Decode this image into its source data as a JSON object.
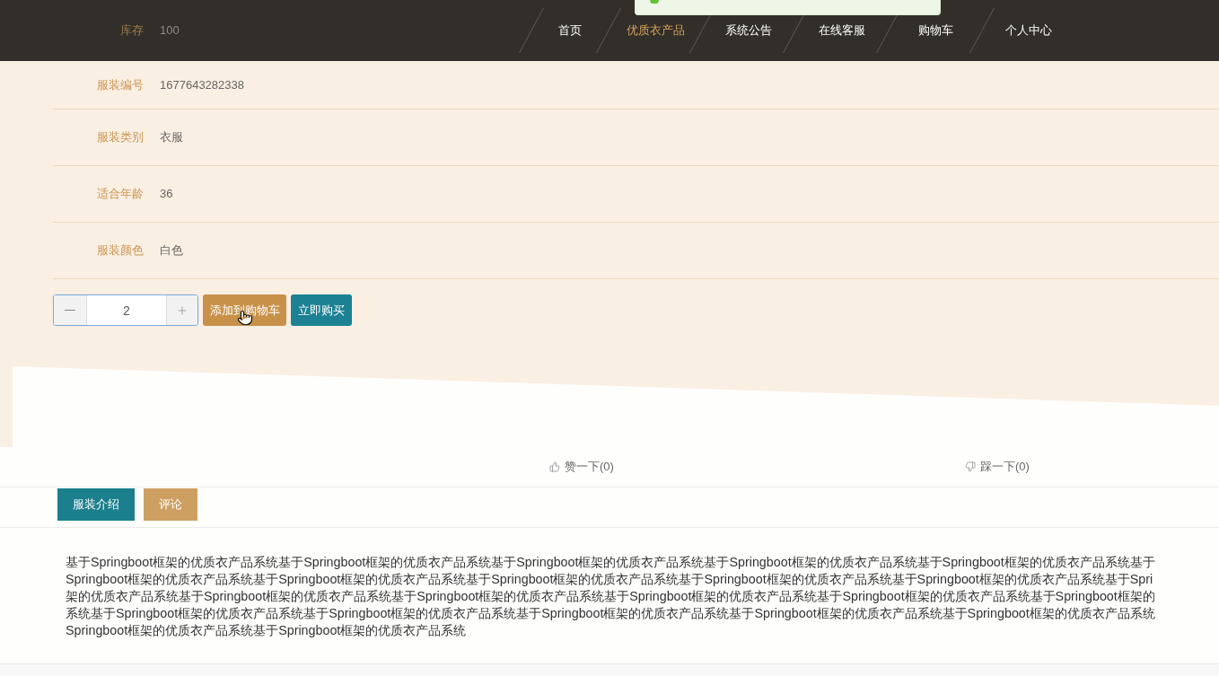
{
  "toast": {
    "kind": "success"
  },
  "nav": [
    {
      "label": "首页",
      "selected": false
    },
    {
      "label": "优质衣产品",
      "selected": true
    },
    {
      "label": "系统公告",
      "selected": false
    },
    {
      "label": "在线客服",
      "selected": false
    },
    {
      "label": "购物车",
      "selected": false
    },
    {
      "label": "个人中心",
      "selected": false
    }
  ],
  "details": [
    {
      "label": "库存",
      "value": "100"
    },
    {
      "label": "服装编号",
      "value": "1677643282338"
    },
    {
      "label": "服装类别",
      "value": "衣服"
    },
    {
      "label": "适合年龄",
      "value": "36"
    },
    {
      "label": "服装颜色",
      "value": "白色"
    }
  ],
  "quantity": {
    "value": "2"
  },
  "buttons": [
    {
      "kind": "add_to_cart",
      "label": "添加到购物车"
    },
    {
      "kind": "buy_now",
      "label": "立即购买"
    }
  ],
  "cursor": {
    "kind": "hand"
  },
  "votes": [
    {
      "kind": "like",
      "label": "赞一下(0)"
    },
    {
      "kind": "dislike",
      "label": "踩一下(0)"
    }
  ],
  "tabs": [
    {
      "label": "服装介绍",
      "selected": true
    },
    {
      "label": "评论",
      "selected": false
    }
  ],
  "description": {
    "lines": [
      "基于Springboot框架的优质衣产品系统基于Springboot框架的优质衣产品系统基于Springboot框架的优质衣产品系统基于Springboot框架的优质衣产品系统基于Springboot框架的优质衣产品系统基于",
      "Springboot框架的优质衣产品系统基于Springboot框架的优质衣产品系统基于Springboot框架的优质衣产品系统基于Springboot框架的优质衣产品系统基于Springboot框架的优质衣产品系统基于Spri",
      "架的优质衣产品系统基于Springboot框架的优质衣产品系统基于Springboot框架的优质衣产品系统基于Springboot框架的优质衣产品系统基于Springboot框架的优质衣产品系统基于Springboot框架的",
      "系统基于Springboot框架的优质衣产品系统基于Springboot框架的优质衣产品系统基于Springboot框架的优质衣产品系统基于Springboot框架的优质衣产品系统基于Springboot框架的优质衣产品系统",
      "Springboot框架的优质衣产品系统基于Springboot框架的优质衣产品系统"
    ]
  }
}
